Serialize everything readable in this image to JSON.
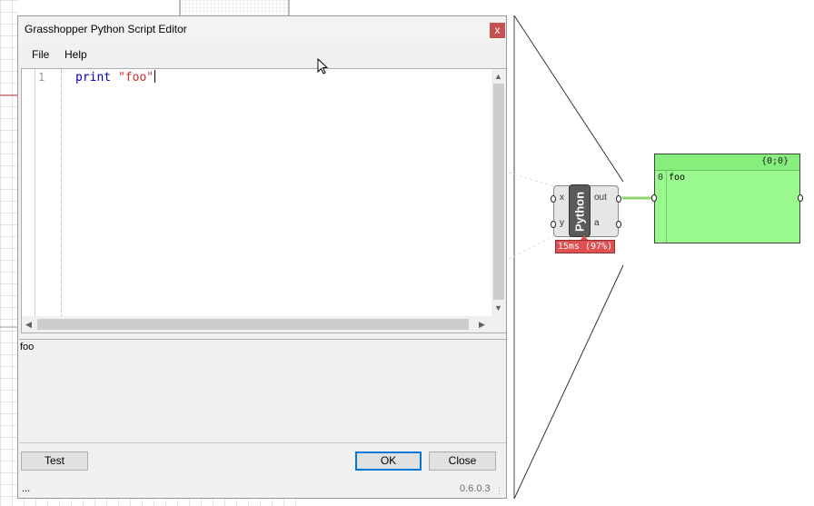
{
  "window": {
    "title": "Grasshopper Python Script Editor",
    "close_glyph": "x"
  },
  "menu": {
    "items": [
      {
        "label": "File"
      },
      {
        "label": "Help"
      }
    ]
  },
  "editor": {
    "line_numbers": [
      "1"
    ],
    "code_keyword": "print",
    "code_string": "\"foo\"",
    "colors": {
      "keyword": "#0000c0",
      "string": "#d03030"
    }
  },
  "output": {
    "text": "foo"
  },
  "buttons": {
    "test": "Test",
    "ok": "OK",
    "close": "Close"
  },
  "status": {
    "left": "...",
    "version": "0.6.0.3"
  },
  "component": {
    "name": "Python",
    "inputs": [
      "x",
      "y"
    ],
    "outputs": [
      "out",
      "a"
    ],
    "timing": "15ms (97%)",
    "colors": {
      "timing": "#e05050"
    }
  },
  "panel": {
    "path": "{0;0}",
    "items": [
      {
        "index": "0",
        "value": "foo"
      }
    ],
    "colors": {
      "fill": "#99f98f",
      "wire": "#8fd36b"
    }
  },
  "icons": {
    "cursor": "mouse-pointer-icon",
    "scroll_up": "scroll-up-icon",
    "scroll_down": "scroll-down-icon",
    "scroll_left": "scroll-left-icon",
    "scroll_right": "scroll-right-icon",
    "resize": "resize-grip-icon"
  }
}
